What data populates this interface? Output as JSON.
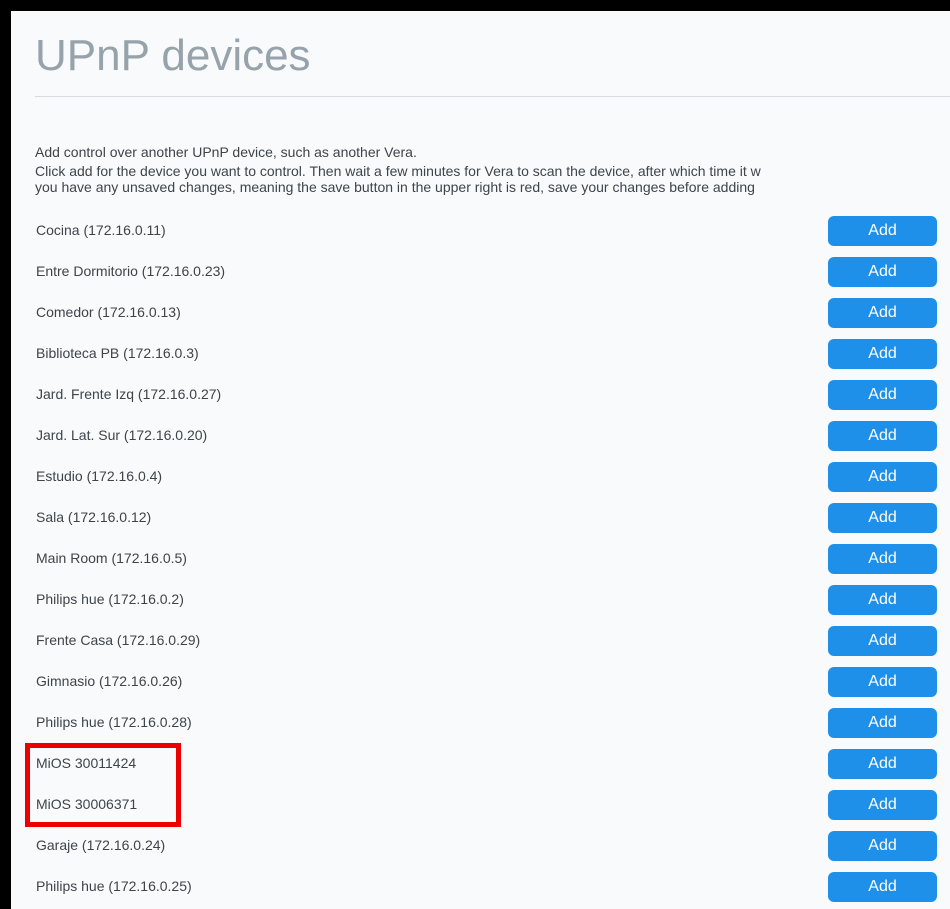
{
  "page": {
    "title": "UPnP devices",
    "intro": "Add control over another UPnP device, such as another Vera.",
    "instructions_line1": "Click add for the device you want to control. Then wait a few minutes for Vera to scan the device, after which time it w",
    "instructions_line2": "you have any unsaved changes, meaning the save button in the upper right is red, save your changes before adding"
  },
  "colors": {
    "add_button": "#1e90ea",
    "highlight": "#ee0000",
    "title": "#97a3ab",
    "frame": "#000000"
  },
  "devices": [
    {
      "name": "Cocina (172.16.0.11)",
      "action": "Add"
    },
    {
      "name": "Entre Dormitorio (172.16.0.23)",
      "action": "Add"
    },
    {
      "name": "Comedor (172.16.0.13)",
      "action": "Add"
    },
    {
      "name": "Biblioteca PB (172.16.0.3)",
      "action": "Add"
    },
    {
      "name": "Jard. Frente Izq (172.16.0.27)",
      "action": "Add"
    },
    {
      "name": "Jard. Lat. Sur (172.16.0.20)",
      "action": "Add"
    },
    {
      "name": "Estudio (172.16.0.4)",
      "action": "Add"
    },
    {
      "name": "Sala (172.16.0.12)",
      "action": "Add"
    },
    {
      "name": "Main Room (172.16.0.5)",
      "action": "Add"
    },
    {
      "name": "Philips hue (172.16.0.2)",
      "action": "Add"
    },
    {
      "name": "Frente Casa (172.16.0.29)",
      "action": "Add"
    },
    {
      "name": "Gimnasio (172.16.0.26)",
      "action": "Add"
    },
    {
      "name": "Philips hue (172.16.0.28)",
      "action": "Add"
    },
    {
      "name": "MiOS 30011424",
      "action": "Add"
    },
    {
      "name": "MiOS 30006371",
      "action": "Add"
    },
    {
      "name": "Garaje (172.16.0.24)",
      "action": "Add"
    },
    {
      "name": "Philips hue (172.16.0.25)",
      "action": "Add"
    }
  ]
}
